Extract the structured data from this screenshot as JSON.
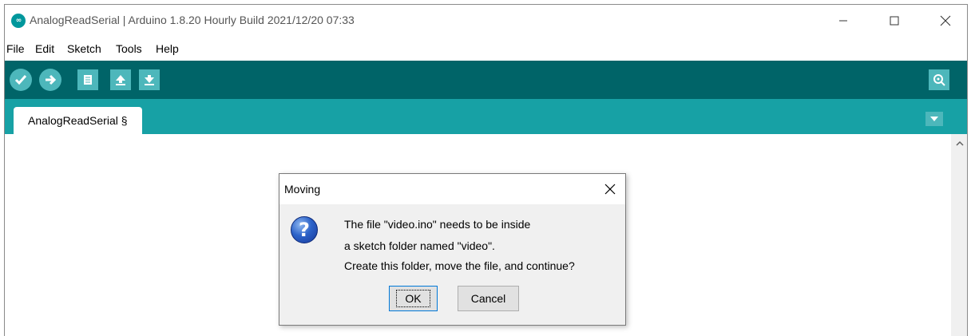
{
  "window": {
    "title": "AnalogReadSerial | Arduino 1.8.20 Hourly Build 2021/12/20 07:33",
    "logo_glyph": "∞"
  },
  "menu": [
    "File",
    "Edit",
    "Sketch",
    "Tools",
    "Help"
  ],
  "toolbar": {
    "buttons": [
      "verify-icon",
      "upload-icon",
      "new-icon",
      "open-icon",
      "save-icon"
    ],
    "right_button": "serial-monitor-icon"
  },
  "tabs": [
    {
      "label": "AnalogReadSerial §"
    }
  ],
  "dialog": {
    "title": "Moving",
    "icon": "question-icon",
    "icon_glyph": "?",
    "message_lines": [
      "The file \"video.ino\" needs to be inside",
      "a sketch folder named \"video\".",
      "Create this folder, move the file, and continue?"
    ],
    "ok_label": "OK",
    "cancel_label": "Cancel"
  },
  "colors": {
    "toolbar": "#006468",
    "tabbar": "#17a1a5",
    "button_accent": "#4db7bb",
    "logo": "#00979c"
  }
}
